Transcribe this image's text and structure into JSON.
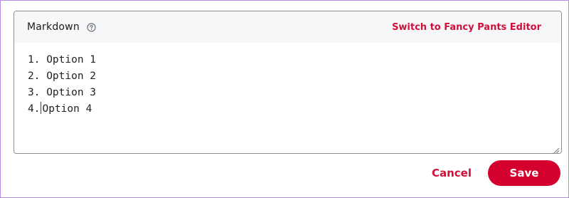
{
  "editor": {
    "mode_label": "Markdown",
    "help_icon": "question-circle-icon",
    "switch_link": "Switch to Fancy Pants Editor",
    "lines": [
      {
        "number": "1.",
        "text": " Option 1"
      },
      {
        "number": "2.",
        "text": " Option 2"
      },
      {
        "number": "3.",
        "text": " Option 3"
      },
      {
        "number": "4.",
        "text": "Option 4"
      }
    ],
    "resize_icon": "resize-grip-icon"
  },
  "actions": {
    "cancel_label": "Cancel",
    "save_label": "Save"
  },
  "colors": {
    "accent": "#d0103a",
    "save_button": "#d4002d",
    "header_background": "#f6f7f8",
    "border": "#8a8f98"
  }
}
